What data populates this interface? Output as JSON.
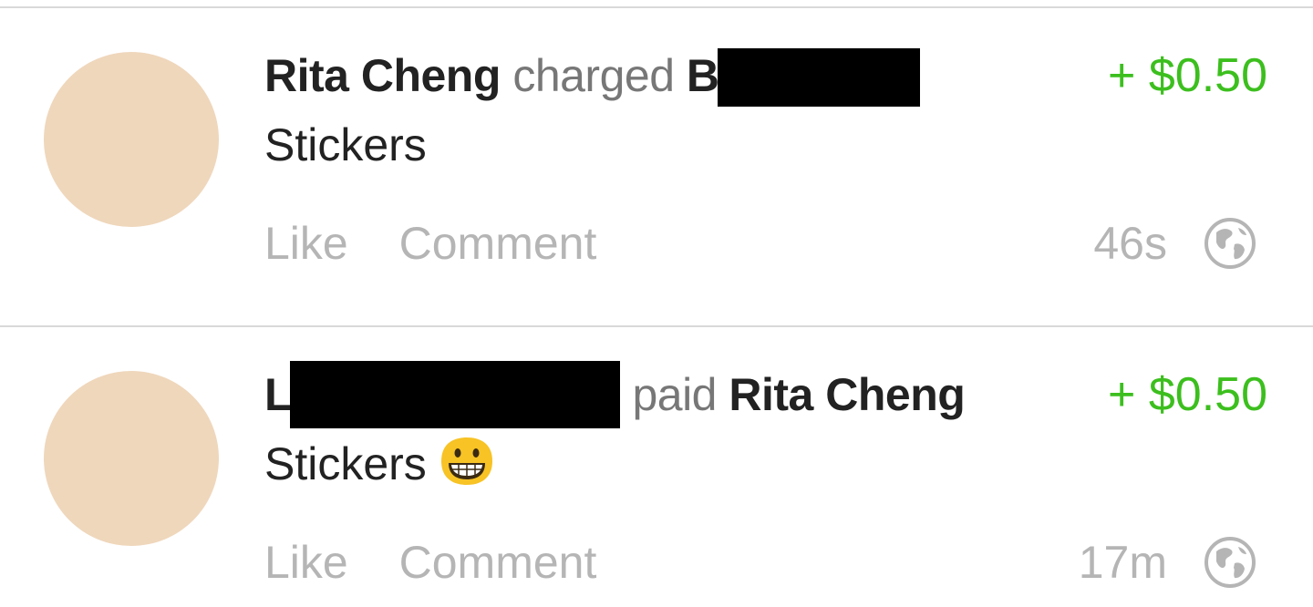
{
  "stories": [
    {
      "actor": "Rita Cheng",
      "verb": "charged",
      "target_visible": "B",
      "amount": "+ $0.50",
      "note": "Stickers",
      "like_label": "Like",
      "comment_label": "Comment",
      "time": "46s",
      "privacy_icon": "globe-icon"
    },
    {
      "actor_visible": "L",
      "verb": "paid",
      "target": "Rita Cheng",
      "amount": "+ $0.50",
      "note": "Stickers",
      "emoji": "grinning-face-icon",
      "like_label": "Like",
      "comment_label": "Comment",
      "time": "17m",
      "privacy_icon": "globe-icon"
    }
  ],
  "colors": {
    "amount": "#3cbf1e",
    "name": "#222222",
    "verb": "#777777",
    "muted": "#b5b5b5",
    "avatar": "#efd7bc",
    "divider": "#d9d9d9"
  }
}
